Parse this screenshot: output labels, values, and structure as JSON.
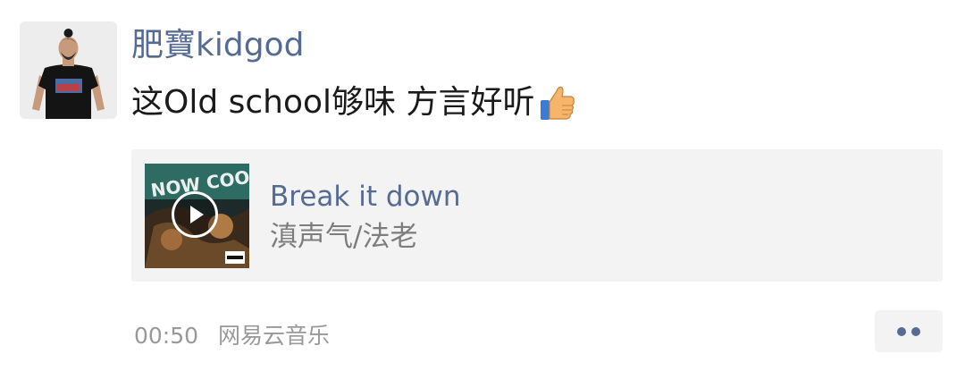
{
  "post": {
    "author": "肥寶kidgod",
    "content": "这Old school够味 方言好听",
    "content_emoji": "thumbs-up-icon"
  },
  "music_card": {
    "title": "Break it down",
    "artist": "滇声气/法老",
    "cover_icon": "album-cover-image",
    "play_icon": "play-icon"
  },
  "meta": {
    "time": "00:50",
    "source": "网易云音乐"
  },
  "actions": {
    "more_icon": "more-dots-icon"
  },
  "colors": {
    "name_blue": "#566b94",
    "card_bg": "#f3f3f3",
    "meta_gray": "#999999",
    "artist_gray": "#7d7d7d"
  }
}
